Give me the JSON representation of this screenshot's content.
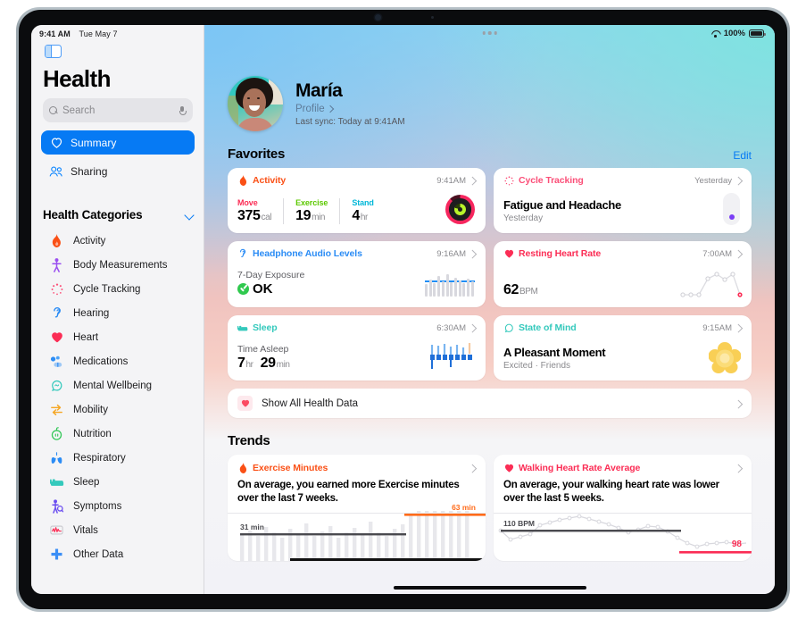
{
  "status_bar": {
    "time": "9:41 AM",
    "date": "Tue May 7",
    "battery": "100%",
    "wifi_icon": "wifi-icon",
    "battery_icon": "battery-full-icon"
  },
  "sidebar": {
    "toggle_icon": "sidebar-toggle-icon",
    "app_title": "Health",
    "search": {
      "placeholder": "Search",
      "value": "",
      "icon": "search-icon",
      "mic_icon": "microphone-icon"
    },
    "nav": [
      {
        "label": "Summary",
        "icon": "heart-icon",
        "selected": true
      },
      {
        "label": "Sharing",
        "icon": "people-icon",
        "selected": false
      }
    ],
    "categories_header": {
      "label": "Health Categories",
      "chevron_icon": "chevron-down-icon"
    },
    "categories": [
      {
        "label": "Activity",
        "icon": "flame-icon",
        "color": "#fa5016"
      },
      {
        "label": "Body Measurements",
        "icon": "body-icon",
        "color": "#9a4ff0"
      },
      {
        "label": "Cycle Tracking",
        "icon": "cycle-icon",
        "color": "#fb4f78"
      },
      {
        "label": "Hearing",
        "icon": "ear-icon",
        "color": "#2b8cf5"
      },
      {
        "label": "Heart",
        "icon": "heart-icon",
        "color": "#fb2d55"
      },
      {
        "label": "Medications",
        "icon": "pills-icon",
        "color": "#2b8cf5"
      },
      {
        "label": "Mental Wellbeing",
        "icon": "head-icon",
        "color": "#34c9bc"
      },
      {
        "label": "Mobility",
        "icon": "mobility-arrows-icon",
        "color": "#f5a623"
      },
      {
        "label": "Nutrition",
        "icon": "apple-icon",
        "color": "#34c759"
      },
      {
        "label": "Respiratory",
        "icon": "lungs-icon",
        "color": "#2b8cf5"
      },
      {
        "label": "Sleep",
        "icon": "bed-icon",
        "color": "#34c9bc"
      },
      {
        "label": "Symptoms",
        "icon": "symptoms-icon",
        "color": "#6a4df0"
      },
      {
        "label": "Vitals",
        "icon": "vitals-waveform-icon",
        "color": "#fb2d55"
      },
      {
        "label": "Other Data",
        "icon": "plus-cross-icon",
        "color": "#3a8ef6"
      }
    ]
  },
  "profile": {
    "avatar_icon": "avatar",
    "name": "María",
    "profile_link": "Profile",
    "chevron_icon": "chevron-right-icon",
    "last_sync": "Last sync: Today at 9:41AM"
  },
  "favorites": {
    "title": "Favorites",
    "edit_label": "Edit",
    "cards": {
      "activity": {
        "title": "Activity",
        "icon": "flame-icon",
        "color": "#fa5016",
        "time": "9:41AM",
        "stats": [
          {
            "label": "Move",
            "color": "#fb2d55",
            "value": "375",
            "unit": "cal"
          },
          {
            "label": "Exercise",
            "color": "#7ae000",
            "value": "19",
            "unit": "min"
          },
          {
            "label": "Stand",
            "color": "#00d4f5",
            "value": "4",
            "unit": "hr"
          }
        ],
        "rings_icon": "activity-rings-icon"
      },
      "cycle_tracking": {
        "title": "Cycle Tracking",
        "icon": "cycle-icon",
        "color": "#fb4f78",
        "time": "Yesterday",
        "headline": "Fatigue and Headache",
        "subtext": "Yesterday",
        "indicator_icon": "cycle-dot-indicator"
      },
      "headphone_audio": {
        "title": "Headphone Audio Levels",
        "icon": "ear-icon",
        "color": "#2b8cf5",
        "time": "9:16AM",
        "label": "7-Day Exposure",
        "status": "OK",
        "status_icon": "checkmark-circle-icon",
        "chart_icon": "audio-levels-chart"
      },
      "resting_heart_rate": {
        "title": "Resting Heart Rate",
        "icon": "heart-icon",
        "color": "#fb2d55",
        "time": "7:00AM",
        "value": "62",
        "unit": "BPM",
        "chart_icon": "heart-rate-sparkline"
      },
      "sleep": {
        "title": "Sleep",
        "icon": "bed-icon",
        "color": "#34c9bc",
        "time": "6:30AM",
        "label": "Time Asleep",
        "value_hours": "7",
        "unit_hours": "hr",
        "value_minutes": "29",
        "unit_minutes": "min",
        "chart_icon": "sleep-stages-chart"
      },
      "state_of_mind": {
        "title": "State of Mind",
        "icon": "head-icon",
        "color": "#34c9bc",
        "time": "9:15AM",
        "headline": "A Pleasant Moment",
        "subtext": "Excited · Friends",
        "mood_icon": "mood-flower-icon"
      }
    },
    "show_all": {
      "label": "Show All Health Data",
      "icon": "heart-icon",
      "chevron_icon": "chevron-right-icon"
    }
  },
  "trends": {
    "title": "Trends",
    "cards": [
      {
        "title": "Exercise Minutes",
        "icon": "flame-icon",
        "color": "#fa5016",
        "chevron_icon": "chevron-right-icon",
        "description": "On average, you earned more Exercise minutes over the last 7 weeks.",
        "baseline_label": "31 min",
        "current_label": "63 min"
      },
      {
        "title": "Walking Heart Rate Average",
        "icon": "heart-icon",
        "color": "#fb2d55",
        "chevron_icon": "chevron-right-icon",
        "description": "On average, your walking heart rate was lower over the last 5 weeks.",
        "baseline_label": "110 BPM",
        "current_label": "98"
      }
    ]
  },
  "chart_data": [
    {
      "type": "bar",
      "title": "Exercise Minutes",
      "ylabel": "minutes",
      "baseline": 31,
      "baseline_label": "31 min",
      "current": 63,
      "current_label": "63 min",
      "values": [
        30,
        36,
        28,
        40,
        33,
        26,
        38,
        31,
        44,
        29,
        35,
        41,
        27,
        34,
        39,
        30,
        46,
        33,
        28,
        37,
        42,
        58,
        66,
        71,
        63,
        69,
        74,
        68,
        72
      ]
    },
    {
      "type": "line",
      "title": "Walking Heart Rate Average",
      "ylabel": "BPM",
      "baseline": 110,
      "baseline_label": "110 BPM",
      "current": 98,
      "current_label": "98",
      "values": [
        104,
        99,
        101,
        105,
        108,
        111,
        113,
        114,
        116,
        115,
        113,
        111,
        108,
        105,
        107,
        110,
        109,
        106,
        101,
        97,
        95,
        97,
        98,
        99,
        98
      ]
    },
    {
      "type": "bar",
      "title": "Headphone Audio Levels 7-Day Exposure",
      "values": [
        8,
        14,
        10,
        18,
        12,
        20,
        11,
        16,
        13,
        9,
        15,
        12
      ]
    },
    {
      "type": "bar",
      "title": "Sleep Stages",
      "values": [
        14,
        20,
        12,
        22,
        16,
        24,
        15,
        19
      ]
    },
    {
      "type": "line",
      "title": "Resting Heart Rate",
      "values": [
        58,
        58,
        58,
        58,
        66,
        62,
        68,
        56
      ],
      "current": 62
    }
  ],
  "home_indicator": "home-indicator"
}
